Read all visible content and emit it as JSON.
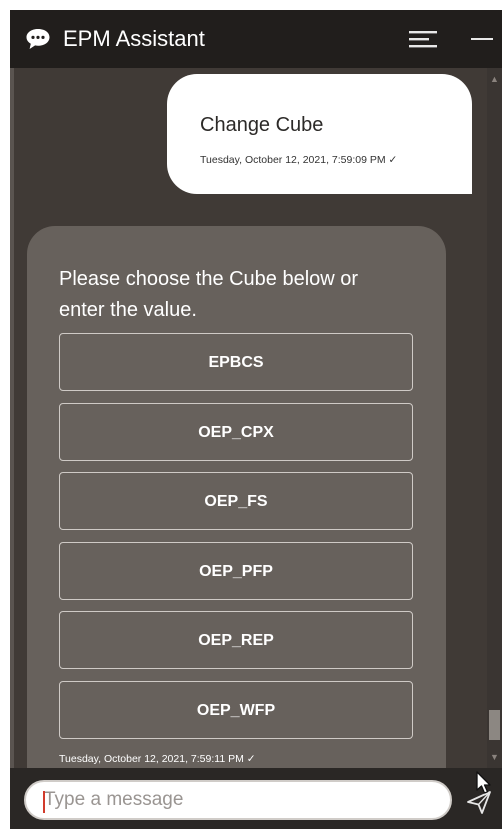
{
  "header": {
    "title": "EPM Assistant"
  },
  "conversation": {
    "user_message": {
      "text": "Change Cube",
      "timestamp": "Tuesday, October 12, 2021, 7:59:09 PM ✓"
    },
    "bot_message": {
      "text": "Please choose the Cube below or enter the value.",
      "options": [
        "EPBCS",
        "OEP_CPX",
        "OEP_FS",
        "OEP_PFP",
        "OEP_REP",
        "OEP_WFP"
      ],
      "timestamp": "Tuesday, October 12, 2021, 7:59:11 PM ✓"
    }
  },
  "input": {
    "placeholder": "Type a message"
  },
  "icons": {
    "header_left": "chat-bubble-icon",
    "header_menu": "hamburger-menu-icon",
    "header_minimize": "minimize-icon",
    "send": "send-icon",
    "cursor": "mouse-pointer-icon"
  },
  "colors": {
    "header_bg": "#211e1c",
    "chat_bg": "#403a36",
    "bot_bubble": "#67615c",
    "user_bubble": "#ffffff",
    "input_bar": "#2a2725"
  }
}
